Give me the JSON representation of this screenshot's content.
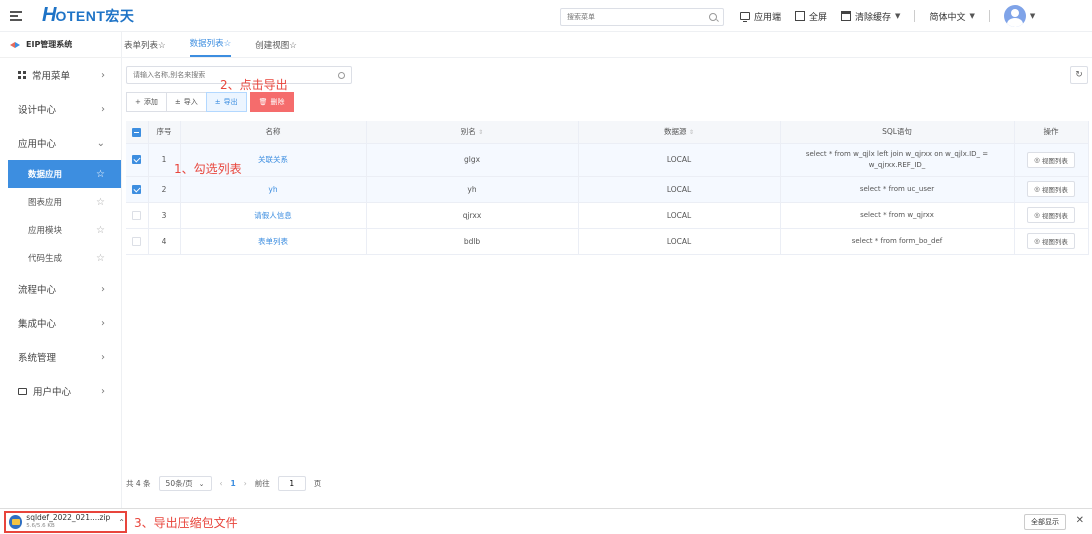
{
  "header": {
    "logo_mark": "H",
    "logo_text": "OTENT宏天",
    "search_placeholder": "搜索菜单",
    "app_side": "应用端",
    "fullscreen": "全屏",
    "clear_cache": "清除缓存",
    "language": "简体中文"
  },
  "sidebar": {
    "system_title": "EIP管理系统",
    "common_menu": "常用菜单",
    "design_center": "设计中心",
    "app_center": "应用中心",
    "app_sub": [
      "数据应用",
      "图表应用",
      "应用模块",
      "代码生成"
    ],
    "process_center": "流程中心",
    "integration_center": "集成中心",
    "system_mgmt": "系统管理",
    "user_center": "用户中心"
  },
  "tabs": [
    "表单列表",
    "数据列表",
    "创建视图"
  ],
  "search": {
    "placeholder": "请输入名称,别名来搜索"
  },
  "toolbar": {
    "add": "添加",
    "import": "导入",
    "export": "导出",
    "delete": "删除"
  },
  "annotations": {
    "step1": "1、勾选列表",
    "step2": "2、点击导出",
    "step3": "3、导出压缩包文件"
  },
  "table": {
    "columns": [
      "序号",
      "名称",
      "别名",
      "数据源",
      "SQL语句",
      "操作"
    ],
    "action_label": "视图列表",
    "rows": [
      {
        "no": "1",
        "name": "关联关系",
        "alias": "glgx",
        "source": "LOCAL",
        "sql": "select * from w_qjlx left join w_qjrxx on w_qjlx.ID_ = w_qjrxx.REF_ID_",
        "checked": true
      },
      {
        "no": "2",
        "name": "yh",
        "alias": "yh",
        "source": "LOCAL",
        "sql": "select * from uc_user",
        "checked": true
      },
      {
        "no": "3",
        "name": "请假人信息",
        "alias": "qjrxx",
        "source": "LOCAL",
        "sql": "select * from w_qjrxx",
        "checked": false
      },
      {
        "no": "4",
        "name": "表单列表",
        "alias": "bdlb",
        "source": "LOCAL",
        "sql": "select * from form_bo_def",
        "checked": false
      }
    ]
  },
  "pager": {
    "total": "共 4 条",
    "page_size": "50条/页",
    "current": "1",
    "goto_label": "前往",
    "goto_value": "1",
    "page_suffix": "页"
  },
  "download": {
    "filename": "sqldef_2022_021....zip",
    "size": "5.6/5.6 KB",
    "show_all": "全部显示"
  }
}
